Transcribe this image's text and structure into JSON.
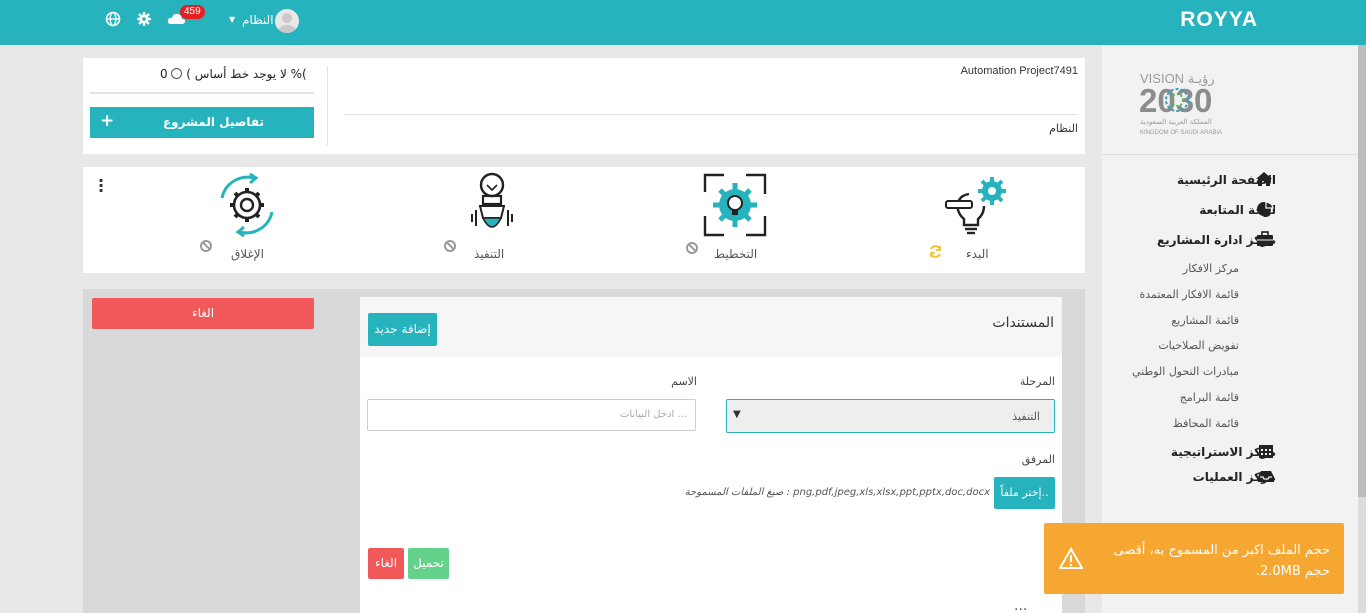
{
  "header": {
    "brand": "ROYYA",
    "user_name": "النظام",
    "notifications_count": "459",
    "icons": [
      "globe-icon",
      "gear-icon",
      "cloud-icon",
      "user-avatar"
    ]
  },
  "sidebar": {
    "logo_alt": "VISION 2030",
    "logo_line1": "VISION رؤيـة",
    "logo_line2": "2030",
    "logo_line3": "المملكة العربية السعودية",
    "logo_line4": "KINGDOM OF SAUDI ARABIA",
    "items": [
      {
        "label": "الصفحة الرئيسية",
        "icon": "home-icon"
      },
      {
        "label": "لوحة المتابعة",
        "icon": "pie-chart-icon"
      },
      {
        "label": "مركز ادارة المشاريع",
        "icon": "briefcase-icon"
      }
    ],
    "sub_items": [
      "مركز الافكار",
      "قائمة الافكار المعتمدة",
      "قائمة المشاريع",
      "تفويض الصلاحيات",
      "مبادرات التحول الوطني",
      "قائمة البرامج",
      "قائمة المحافظ"
    ],
    "bottom_items": [
      {
        "label": "مركز الاستراتيجية",
        "icon": "calendar-icon"
      },
      {
        "label": "مركز العمليات",
        "icon": "inbox-icon"
      }
    ]
  },
  "project": {
    "name": "Automation Project7491",
    "owner": "النظام",
    "baseline": "0 %(",
    "baseline_text": "لا يوجد خط أساس )",
    "details_button": "تفاصيل المشروع",
    "details_plus": "+"
  },
  "phases": [
    {
      "label": "البدء",
      "icon": "lightbulb-gear-icon",
      "status_icon": "refresh-icon"
    },
    {
      "label": "التخطيط",
      "icon": "planning-cycle-icon",
      "status_icon": "ban-icon"
    },
    {
      "label": "التنفيذ",
      "icon": "rocket-bulb-icon",
      "status_icon": "ban-icon"
    },
    {
      "label": "الإغلاق",
      "icon": "gear-cycle-icon",
      "status_icon": "ban-icon"
    }
  ],
  "side_panel": {
    "cancel_button": "الغاء"
  },
  "documents": {
    "title": "المستندات",
    "add_button": "إضافة جديد",
    "stage_label": "المرحلة",
    "stage_value": "التنفيذ",
    "name_label": "الاسم",
    "name_placeholder": "ادخل البيانات ...",
    "attachment_label": "المرفق",
    "choose_file_button": "إختر ملفاً..",
    "allowed_formats": "صيغ الملفات المسموحة : png,pdf,jpeg,xls,xlsx,ppt,pptx,doc,docx",
    "upload_button": "تحميل",
    "cancel_button": "الغاء",
    "more": "..."
  },
  "toast": {
    "message": "حجم الملف اكبر من المسموح به، أقصى حجم 2.0MB.",
    "icon": "warning-icon",
    "color": "#f6a732"
  },
  "colors": {
    "accent": "#26b3bd",
    "danger": "#f0585a",
    "success": "#63d38b"
  }
}
